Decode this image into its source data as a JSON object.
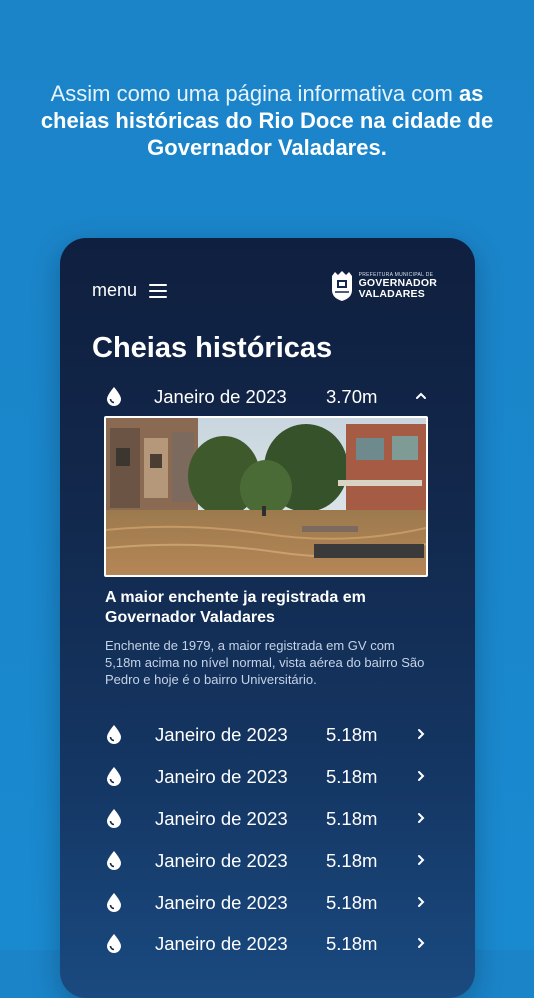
{
  "headline": {
    "light": "Assim como uma página informativa com ",
    "bold": "as cheias históricas do Rio Doce na cidade de Governador Valadares."
  },
  "app": {
    "menu_label": "menu",
    "logo": {
      "small_text": "PREFEITURA MUNICIPAL DE",
      "line1": "GOVERNADOR",
      "line2": "VALADARES"
    },
    "page_title": "Cheias históricas",
    "expanded": {
      "date": "Janeiro de 2023",
      "level": "3.70m",
      "photo_description_title": "A maior enchente ja registrada em Governador Valadares",
      "photo_description_text": "Enchente de 1979, a maior registrada em GV com 5,18m acima no nível normal, vista aérea do bairro São Pedro e hoje é o bairro Universitário."
    },
    "rows": [
      {
        "date": "Janeiro de 2023",
        "level": "5.18m"
      },
      {
        "date": "Janeiro de 2023",
        "level": "5.18m"
      },
      {
        "date": "Janeiro de 2023",
        "level": "5.18m"
      },
      {
        "date": "Janeiro de 2023",
        "level": "5.18m"
      },
      {
        "date": "Janeiro de 2023",
        "level": "5.18m"
      },
      {
        "date": "Janeiro de 2023",
        "level": "5.18m"
      }
    ]
  },
  "colors": {
    "background": "#1b84c9",
    "card": "#12284c",
    "text": "#ffffff",
    "muted_text": "#c5d3e6"
  },
  "icons": [
    "hamburger-icon",
    "water-drop-icon",
    "chevron-up-icon",
    "chevron-right-icon",
    "city-crest-icon"
  ]
}
